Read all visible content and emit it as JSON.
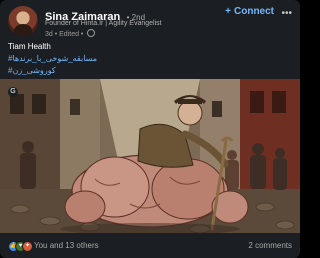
{
  "post": {
    "author": {
      "name": "Sina Zaimaran",
      "degree": "• 2nd",
      "headline": "Founder of Hinta.Ir | Agility Evangelist",
      "meta": "3d • Edited •"
    },
    "actions": {
      "connect_label": "Connect",
      "more_label": "•••"
    },
    "text": {
      "line1": "Tiam Health",
      "line2": "#مسابقه_شوخی_با_برندها",
      "line3": "#کوروشی_زن"
    },
    "image": {
      "badge": "G"
    },
    "social": {
      "reactions_text": "You and 13 others",
      "comments_text": "2 comments"
    }
  },
  "colors": {
    "card_bg": "#1b1f23",
    "link_blue": "#71b7fb",
    "muted_text": "#a8a8a8"
  },
  "icons": [
    "globe-icon",
    "plus-icon",
    "more-icon",
    "like-reaction-icon",
    "support-reaction-icon",
    "celebrate-reaction-icon"
  ]
}
